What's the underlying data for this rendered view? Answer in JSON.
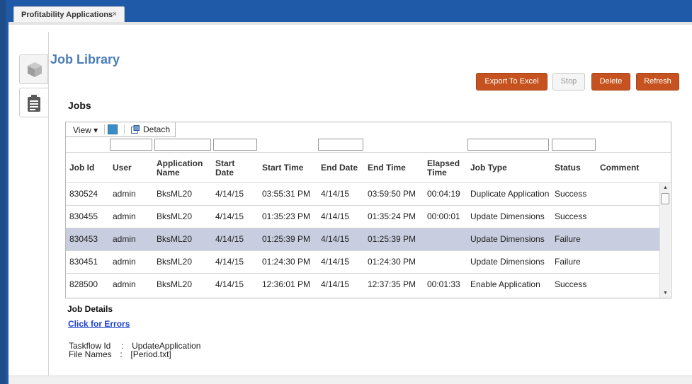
{
  "app_tab": {
    "label": "Profitability Applications",
    "close": "×"
  },
  "page_title": "Job Library",
  "buttons": {
    "export": "Export To Excel",
    "stop": "Stop",
    "delete": "Delete",
    "refresh": "Refresh"
  },
  "jobs": {
    "title": "Jobs",
    "toolbar": {
      "view": "View ▾",
      "detach": "Detach"
    },
    "columns": [
      "Job Id",
      "User",
      "Application Name",
      "Start Date",
      "Start Time",
      "End Date",
      "End Time",
      "Elapsed Time",
      "Job Type",
      "Status",
      "Comment"
    ],
    "rows": [
      {
        "job_id": "830524",
        "user": "admin",
        "app": "BksML20",
        "start_date": "4/14/15",
        "start_time": "03:55:31 PM",
        "end_date": "4/14/15",
        "end_time": "03:59:50 PM",
        "elapsed": "00:04:19",
        "job_type": "Duplicate Application",
        "status": "Success",
        "comment": ""
      },
      {
        "job_id": "830455",
        "user": "admin",
        "app": "BksML20",
        "start_date": "4/14/15",
        "start_time": "01:35:23 PM",
        "end_date": "4/14/15",
        "end_time": "01:35:24 PM",
        "elapsed": "00:00:01",
        "job_type": "Update Dimensions",
        "status": "Success",
        "comment": ""
      },
      {
        "job_id": "830453",
        "user": "admin",
        "app": "BksML20",
        "start_date": "4/14/15",
        "start_time": "01:25:39 PM",
        "end_date": "4/14/15",
        "end_time": "01:25:39 PM",
        "elapsed": "",
        "job_type": "Update Dimensions",
        "status": "Failure",
        "comment": "",
        "selected": true
      },
      {
        "job_id": "830451",
        "user": "admin",
        "app": "BksML20",
        "start_date": "4/14/15",
        "start_time": "01:24:30 PM",
        "end_date": "4/14/15",
        "end_time": "01:24:30 PM",
        "elapsed": "",
        "job_type": "Update Dimensions",
        "status": "Failure",
        "comment": ""
      },
      {
        "job_id": "828500",
        "user": "admin",
        "app": "BksML20",
        "start_date": "4/14/15",
        "start_time": "12:36:01 PM",
        "end_date": "4/14/15",
        "end_time": "12:37:35 PM",
        "elapsed": "00:01:33",
        "job_type": "Enable Application",
        "status": "Success",
        "comment": ""
      }
    ]
  },
  "details": {
    "title": "Job Details",
    "errors_link": "Click for Errors",
    "taskflow_label": "Taskflow Id",
    "taskflow_value": "UpdateApplication",
    "files_label": "File Names",
    "files_value": "[Period.txt]",
    "separator": ":"
  },
  "colors": {
    "accent": "#c6531f",
    "title_blue": "#4a7db8",
    "frame_blue": "#1e5aa8",
    "selected_row": "#c8cee0",
    "link": "#1a3fd1"
  },
  "icons": [
    "cube-icon",
    "clipboard-list-icon",
    "edit-grid-icon",
    "detach-icon",
    "close-icon"
  ]
}
